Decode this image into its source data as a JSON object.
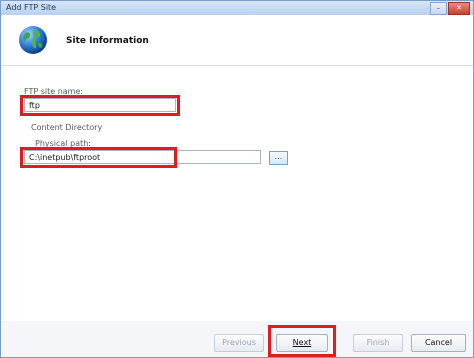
{
  "window": {
    "title": "Add FTP Site"
  },
  "header": {
    "title": "Site Information",
    "icon": "globe-icon"
  },
  "form": {
    "site_name_label": "FTP site name:",
    "site_name_value": "ftp",
    "content_directory_label": "Content Directory",
    "physical_path_label": "Physical path:",
    "physical_path_value": "C:\\inetpub\\ftproot",
    "browse_label": "..."
  },
  "buttons": {
    "previous": "Previous",
    "next": "Next",
    "finish": "Finish",
    "cancel": "Cancel"
  },
  "colors": {
    "highlight": "#e01b23",
    "title_bar": "#b9d0ee"
  }
}
